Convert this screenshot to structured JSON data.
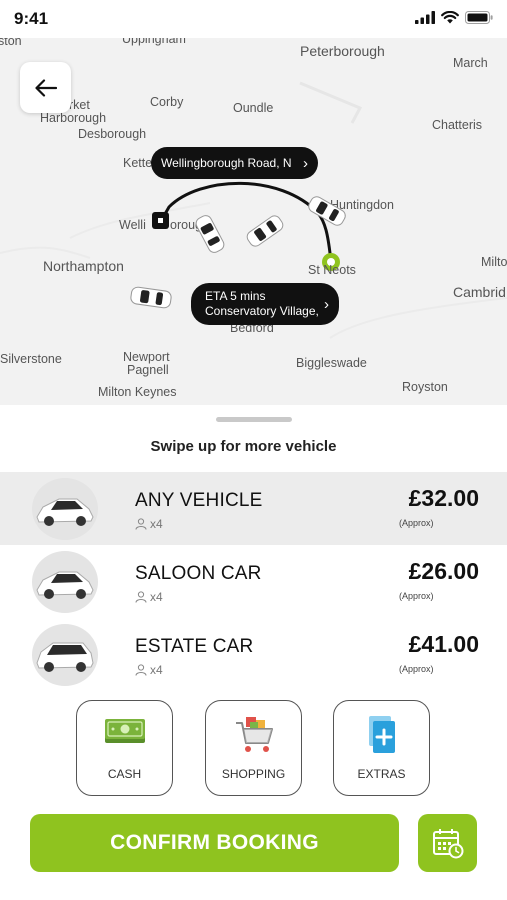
{
  "status_bar": {
    "time": "9:41"
  },
  "map": {
    "towns": [
      {
        "key": "ston",
        "label": "ston"
      },
      {
        "key": "uppingham",
        "label": "Uppingham"
      },
      {
        "key": "peterborough",
        "label": "Peterborough"
      },
      {
        "key": "march",
        "label": "March"
      },
      {
        "key": "market_harborough_1",
        "label": "arket"
      },
      {
        "key": "market_harborough_2",
        "label": "Harborough"
      },
      {
        "key": "corby",
        "label": "Corby"
      },
      {
        "key": "oundle",
        "label": "Oundle"
      },
      {
        "key": "chatteris",
        "label": "Chatteris"
      },
      {
        "key": "desborough",
        "label": "Desborough"
      },
      {
        "key": "kettering",
        "label": "Kette"
      },
      {
        "key": "huntingdon",
        "label": "Huntingdon"
      },
      {
        "key": "wellingborough",
        "label": "Welli"
      },
      {
        "key": "wellingborough_2",
        "label": "orough"
      },
      {
        "key": "northampton",
        "label": "Northampton"
      },
      {
        "key": "st_neots",
        "label": "St Neots"
      },
      {
        "key": "milton",
        "label": "Milto"
      },
      {
        "key": "cambridge",
        "label": "Cambrid"
      },
      {
        "key": "bedford",
        "label": "Bedford"
      },
      {
        "key": "silverstone",
        "label": "Silverstone"
      },
      {
        "key": "newport_pagnell_1",
        "label": "Newport"
      },
      {
        "key": "newport_pagnell_2",
        "label": "Pagnell"
      },
      {
        "key": "biggleswade",
        "label": "Biggleswade"
      },
      {
        "key": "royston",
        "label": "Royston"
      },
      {
        "key": "milton_keynes",
        "label": "Milton Keynes"
      }
    ],
    "pickup_label": "Wellingborough Road, N",
    "eta_line1": "ETA 5 mins",
    "eta_line2": "Conservatory Village,"
  },
  "sheet": {
    "swipe_hint": "Swipe up for more vehicle",
    "vehicles": [
      {
        "name": "ANY VEHICLE",
        "seats": "x4",
        "price": "£32.00",
        "approx": "(Approx)",
        "selected": true
      },
      {
        "name": "SALOON CAR",
        "seats": "x4",
        "price": "£26.00",
        "approx": "(Approx)",
        "selected": false
      },
      {
        "name": "ESTATE CAR",
        "seats": "x4",
        "price": "£41.00",
        "approx": "(Approx)",
        "selected": false
      }
    ],
    "options": [
      {
        "label": "CASH",
        "icon": "cash-icon"
      },
      {
        "label": "SHOPPING",
        "icon": "shopping-cart-icon"
      },
      {
        "label": "EXTRAS",
        "icon": "extras-icon"
      }
    ],
    "confirm_label": "CONFIRM BOOKING",
    "schedule_icon": "calendar-clock-icon"
  },
  "colors": {
    "accent": "#8fc31f",
    "route": "#111111",
    "destination": "#8fc31f"
  }
}
